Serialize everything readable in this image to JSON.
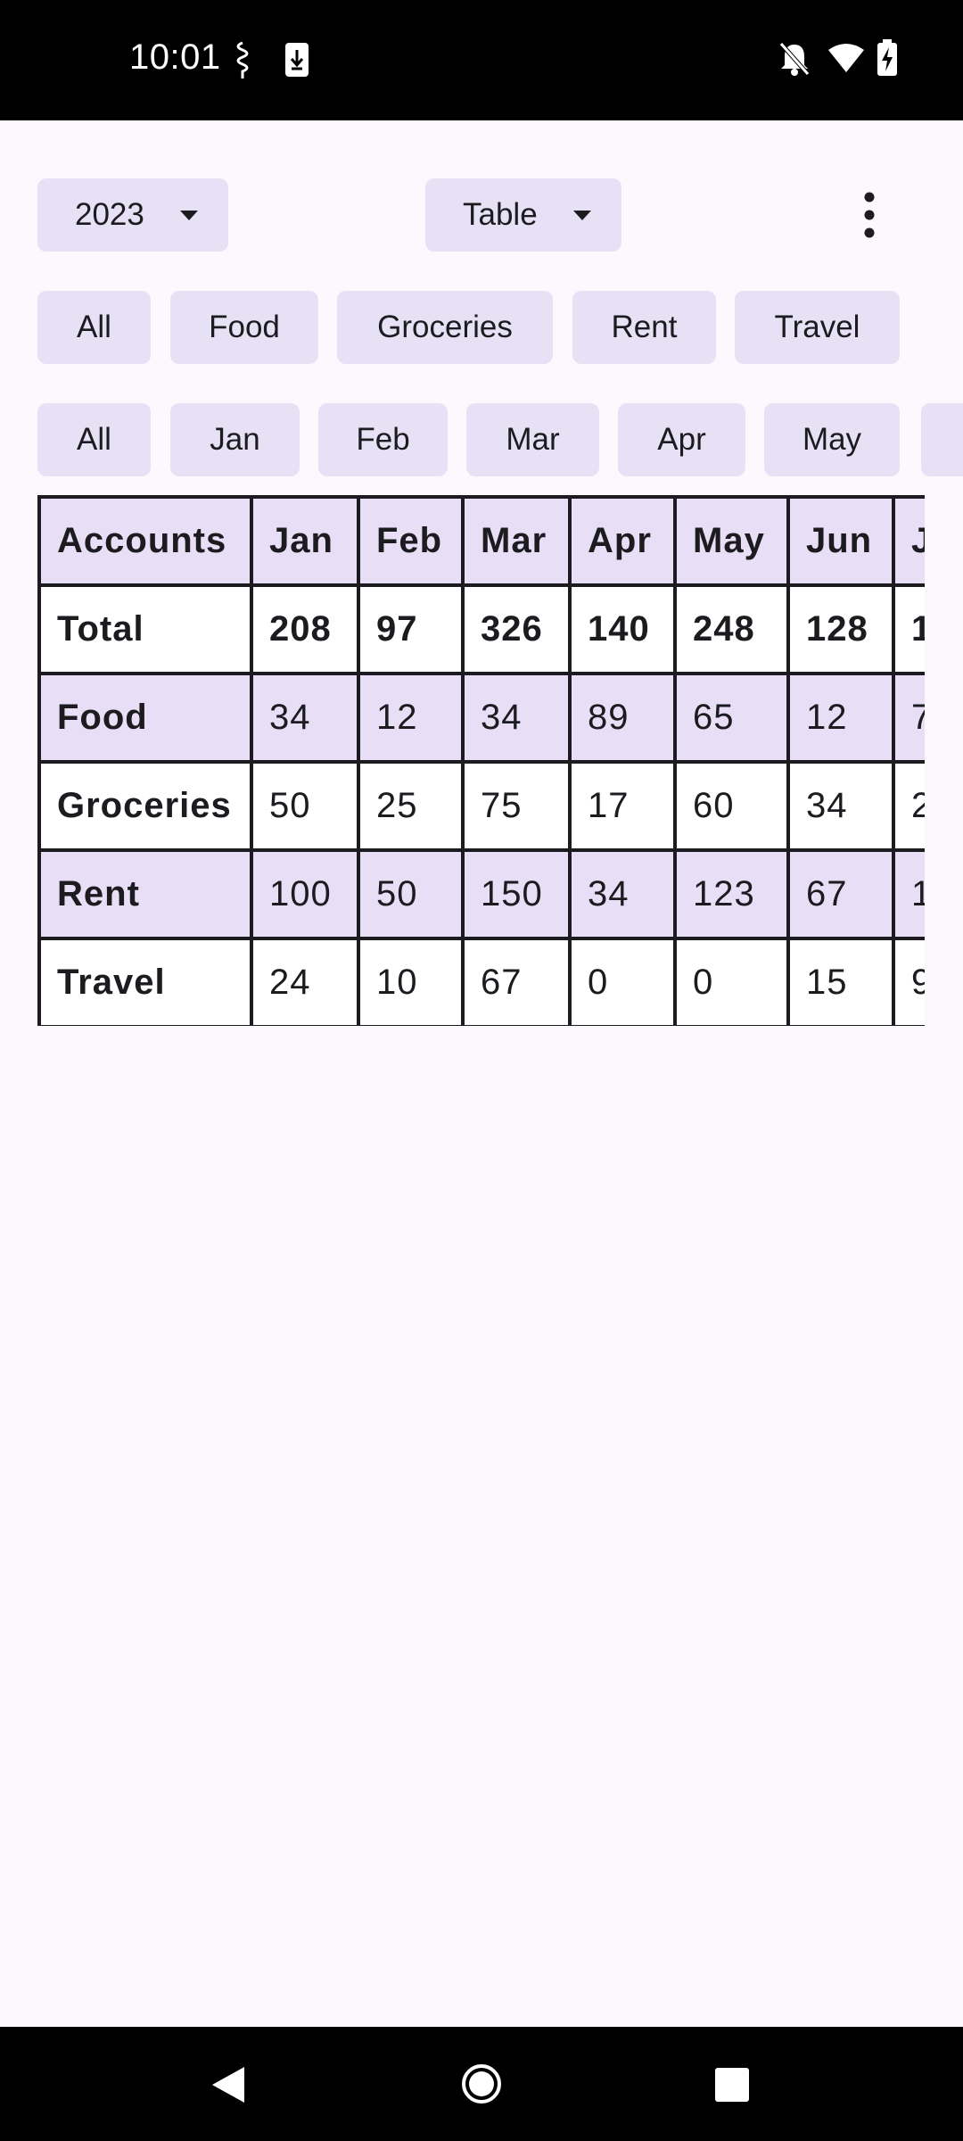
{
  "status_bar": {
    "time": "10:01"
  },
  "toolbar": {
    "year": "2023",
    "view": "Table"
  },
  "account_filters": [
    "All",
    "Food",
    "Groceries",
    "Rent",
    "Travel"
  ],
  "month_filters": [
    "All",
    "Jan",
    "Feb",
    "Mar",
    "Apr",
    "May"
  ],
  "table": {
    "headers": [
      "Accounts",
      "Jan",
      "Feb",
      "Mar",
      "Apr",
      "May",
      "Jun",
      "J"
    ],
    "rows": [
      {
        "name": "Total",
        "values": [
          "208",
          "97",
          "326",
          "140",
          "248",
          "128",
          "1"
        ]
      },
      {
        "name": "Food",
        "values": [
          "34",
          "12",
          "34",
          "89",
          "65",
          "12",
          "7"
        ]
      },
      {
        "name": "Groceries",
        "values": [
          "50",
          "25",
          "75",
          "17",
          "60",
          "34",
          "2"
        ]
      },
      {
        "name": "Rent",
        "values": [
          "100",
          "50",
          "150",
          "34",
          "123",
          "67",
          "1"
        ]
      },
      {
        "name": "Travel",
        "values": [
          "24",
          "10",
          "67",
          "0",
          "0",
          "15",
          "9"
        ]
      }
    ]
  },
  "colors": {
    "chip": "#E7E1F6",
    "row_highlight": "#E8DFF7",
    "background": "#FCF8FD"
  }
}
